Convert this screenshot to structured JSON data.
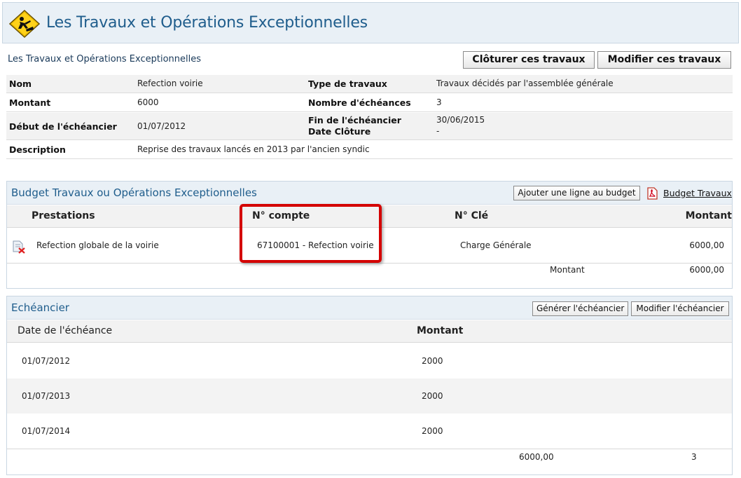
{
  "header": {
    "title": "Les Travaux et Opérations Exceptionnelles",
    "logo_icon": "construction-worker-icon"
  },
  "details": {
    "section_title": "Les Travaux et Opérations Exceptionnelles",
    "buttons": {
      "close": "Clôturer ces travaux",
      "edit": "Modifier ces travaux"
    },
    "rows": {
      "nom_label": "Nom",
      "nom_value": "Refection voirie",
      "type_label": "Type de travaux",
      "type_value": "Travaux décidés par l'assemblée générale",
      "montant_label": "Montant",
      "montant_value": "6000",
      "nb_echeances_label": "Nombre d'échéances",
      "nb_echeances_value": "3",
      "debut_label": "Début de l'échéancier",
      "debut_value": "01/07/2012",
      "fin_label": "Fin de l'échéancier",
      "fin_value": "30/06/2015",
      "cloture_label": "Date Clôture",
      "cloture_value": "-",
      "description_label": "Description",
      "description_value": "Reprise des travaux lancés en 2013 par l'ancien syndic"
    }
  },
  "budget": {
    "title": "Budget Travaux ou Opérations Exceptionnelles",
    "add_line_button": "Ajouter une ligne au budget",
    "pdf_link": "Budget Travaux",
    "columns": {
      "prestations": "Prestations",
      "compte": "N° compte",
      "cle": "N° Clé",
      "montant": "Montant"
    },
    "rows": [
      {
        "prestation": "Refection globale de la voirie",
        "compte": "67100001 - Refection voirie",
        "cle": "Charge Générale",
        "montant": "6000,00"
      }
    ],
    "total_label": "Montant",
    "total_value": "6000,00"
  },
  "echeancier": {
    "title": "Echéancier",
    "generate_button": "Générer l'échéancier",
    "modify_button": "Modifier l'échéancier",
    "columns": {
      "date": "Date de l'échéance",
      "montant": "Montant"
    },
    "rows": [
      {
        "date": "01/07/2012",
        "montant": "2000"
      },
      {
        "date": "01/07/2013",
        "montant": "2000"
      },
      {
        "date": "01/07/2014",
        "montant": "2000"
      }
    ],
    "total_amount": "6000,00",
    "total_count": "3"
  },
  "colors": {
    "title_blue": "#1f5d8c",
    "header_bg": "#e9f0f6",
    "highlight_red": "#d40000"
  }
}
